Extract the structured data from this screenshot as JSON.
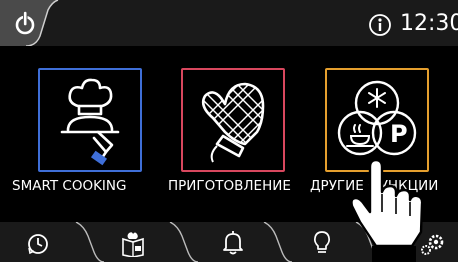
{
  "header": {
    "clock": "12:30",
    "icons": [
      "power-icon",
      "info-icon"
    ]
  },
  "menu": {
    "items": [
      {
        "label": "SMART COOKING",
        "icon": "chef-cloche-icon",
        "color": "#3f6fd8"
      },
      {
        "label": "ПРИГОТОВЛЕНИЕ",
        "icon": "oven-mitt-icon",
        "color": "#d8475e"
      },
      {
        "label": "ДРУГИЕ ФУНКЦИИ",
        "icon": "functions-icon",
        "color": "#e59f2e"
      }
    ]
  },
  "footer": {
    "icons": [
      "timer-icon",
      "recipe-book-icon",
      "bell-icon",
      "lightbulb-icon",
      "settings-icon"
    ]
  }
}
